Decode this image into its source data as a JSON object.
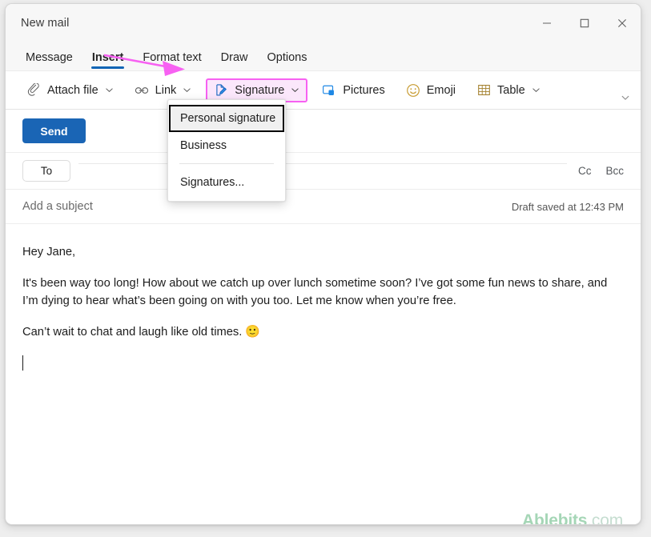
{
  "window": {
    "title": "New mail",
    "controls": [
      {
        "name": "minimize",
        "glyph": "minimize-icon"
      },
      {
        "name": "maximize",
        "glyph": "maximize-icon"
      },
      {
        "name": "close",
        "glyph": "close-icon"
      }
    ]
  },
  "tabs": [
    {
      "label": "Message",
      "active": false
    },
    {
      "label": "Insert",
      "active": true
    },
    {
      "label": "Format text",
      "active": false
    },
    {
      "label": "Draw",
      "active": false
    },
    {
      "label": "Options",
      "active": false
    }
  ],
  "ribbon": {
    "items": [
      {
        "label": "Attach file",
        "icon": "paperclip-icon",
        "caret": true,
        "highlighted": false
      },
      {
        "label": "Link",
        "icon": "link-icon",
        "caret": true,
        "highlighted": false
      },
      {
        "label": "Signature",
        "icon": "signature-icon",
        "caret": true,
        "highlighted": true
      },
      {
        "label": "Pictures",
        "icon": "pictures-icon",
        "caret": false,
        "highlighted": false
      },
      {
        "label": "Emoji",
        "icon": "emoji-icon",
        "caret": false,
        "highlighted": false
      },
      {
        "label": "Table",
        "icon": "table-icon",
        "caret": true,
        "highlighted": false
      }
    ],
    "collapse_icon": "chevron-down-icon",
    "highlight_color": "#f761f2",
    "highlight_fill": "#fbe7fb"
  },
  "signature_menu": {
    "items": [
      {
        "label": "Personal signature",
        "focused": true,
        "separator_after": false
      },
      {
        "label": "Business",
        "focused": false,
        "separator_after": true
      },
      {
        "label": "Signatures...",
        "focused": false,
        "separator_after": false
      }
    ]
  },
  "compose": {
    "send_label": "Send",
    "send_color": "#1a65b5",
    "to_label": "To",
    "cc_label": "Cc",
    "bcc_label": "Bcc",
    "subject_placeholder": "Add a subject",
    "draft_status": "Draft saved at 12:43 PM",
    "body": {
      "greeting": "Hey Jane,",
      "paragraph": "It's been way too long! How about we catch up over lunch sometime soon? I’ve got some fun news to share, and I’m dying to hear what’s been going on with you too. Let me know when you’re free.",
      "closing": "Can’t wait to chat and laugh like old times.",
      "emoji": "🙂"
    }
  },
  "watermark": {
    "bold_part": "Ablebits",
    "light_part": ".com"
  },
  "annotation": {
    "arrow_color": "#f761f2"
  }
}
